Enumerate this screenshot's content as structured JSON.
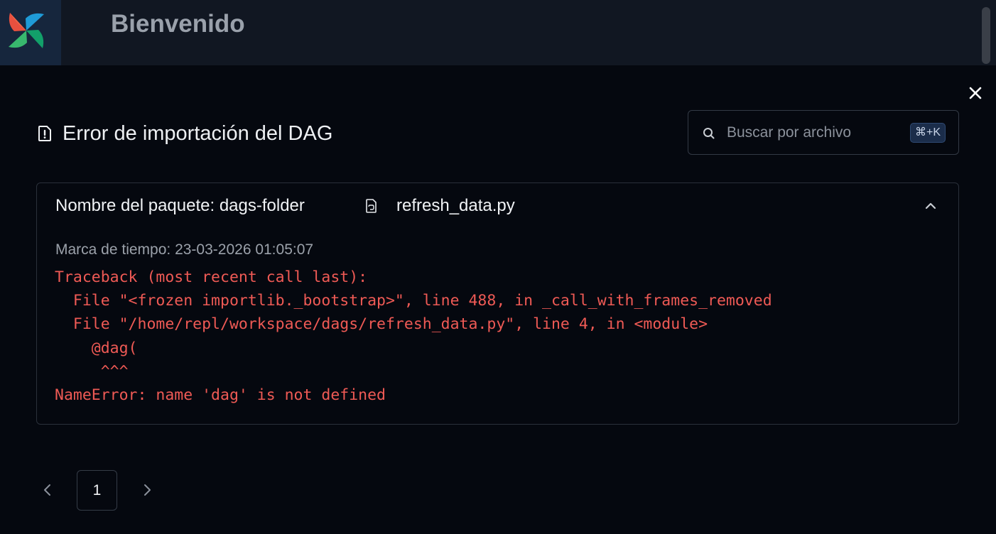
{
  "header": {
    "title": "Bienvenido",
    "logo_icon": "pinwheel-logo-icon"
  },
  "modal": {
    "title": "Error de importación del DAG",
    "title_icon": "file-warning-icon",
    "close_icon": "close-icon",
    "search": {
      "placeholder": "Buscar por archivo",
      "value": "",
      "shortcut": "⌘+K"
    },
    "errors": [
      {
        "bundle_label": "Nombre del paquete: dags-folder",
        "file_icon": "python-file-icon",
        "file_name": "refresh_data.py",
        "timestamp": "Marca de tiempo: 23-03-2026 01:05:07",
        "expanded": true,
        "traceback": "Traceback (most recent call last):\n  File \"<frozen importlib._bootstrap>\", line 488, in _call_with_frames_removed\n  File \"/home/repl/workspace/dags/refresh_data.py\", line 4, in <module>\n    @dag(\n     ^^^\nNameError: name 'dag' is not defined"
      }
    ],
    "pagination": {
      "current_page": "1",
      "prev_icon": "chevron-left-icon",
      "next_icon": "chevron-right-icon"
    }
  },
  "colors": {
    "background": "#05080f",
    "topbar": "#111722",
    "error_text": "#ef5a55",
    "border": "#2a303a"
  }
}
